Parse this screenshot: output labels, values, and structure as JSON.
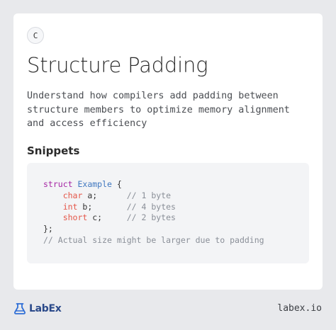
{
  "card": {
    "badge": "C",
    "title": "Structure Padding",
    "description": "Understand how compilers add padding between structure members to optimize memory alignment and access efficiency",
    "snippets_heading": "Snippets",
    "code": {
      "line1": {
        "kw": "struct",
        "name": "Example",
        "rest": " {"
      },
      "line2": {
        "indent": "    ",
        "type": "char",
        "rest": " a;      ",
        "comment": "// 1 byte"
      },
      "line3": {
        "indent": "    ",
        "type": "int",
        "rest": " b;       ",
        "comment": "// 4 bytes"
      },
      "line4": {
        "indent": "    ",
        "type": "short",
        "rest": " c;     ",
        "comment": "// 2 bytes"
      },
      "line5": {
        "text": "};"
      },
      "line6": {
        "comment": "// Actual size might be larger due to padding"
      }
    }
  },
  "footer": {
    "logo_text": "LabEx",
    "logo_icon": "flask-icon",
    "site": "labex.io"
  },
  "colors": {
    "background": "#e8e9ec",
    "card": "#ffffff",
    "code_bg": "#f3f4f6",
    "keyword": "#a626a4",
    "type": "#e45649",
    "struct_name": "#4078c0",
    "comment": "#8a8f98",
    "brand": "#2b4a8a"
  }
}
